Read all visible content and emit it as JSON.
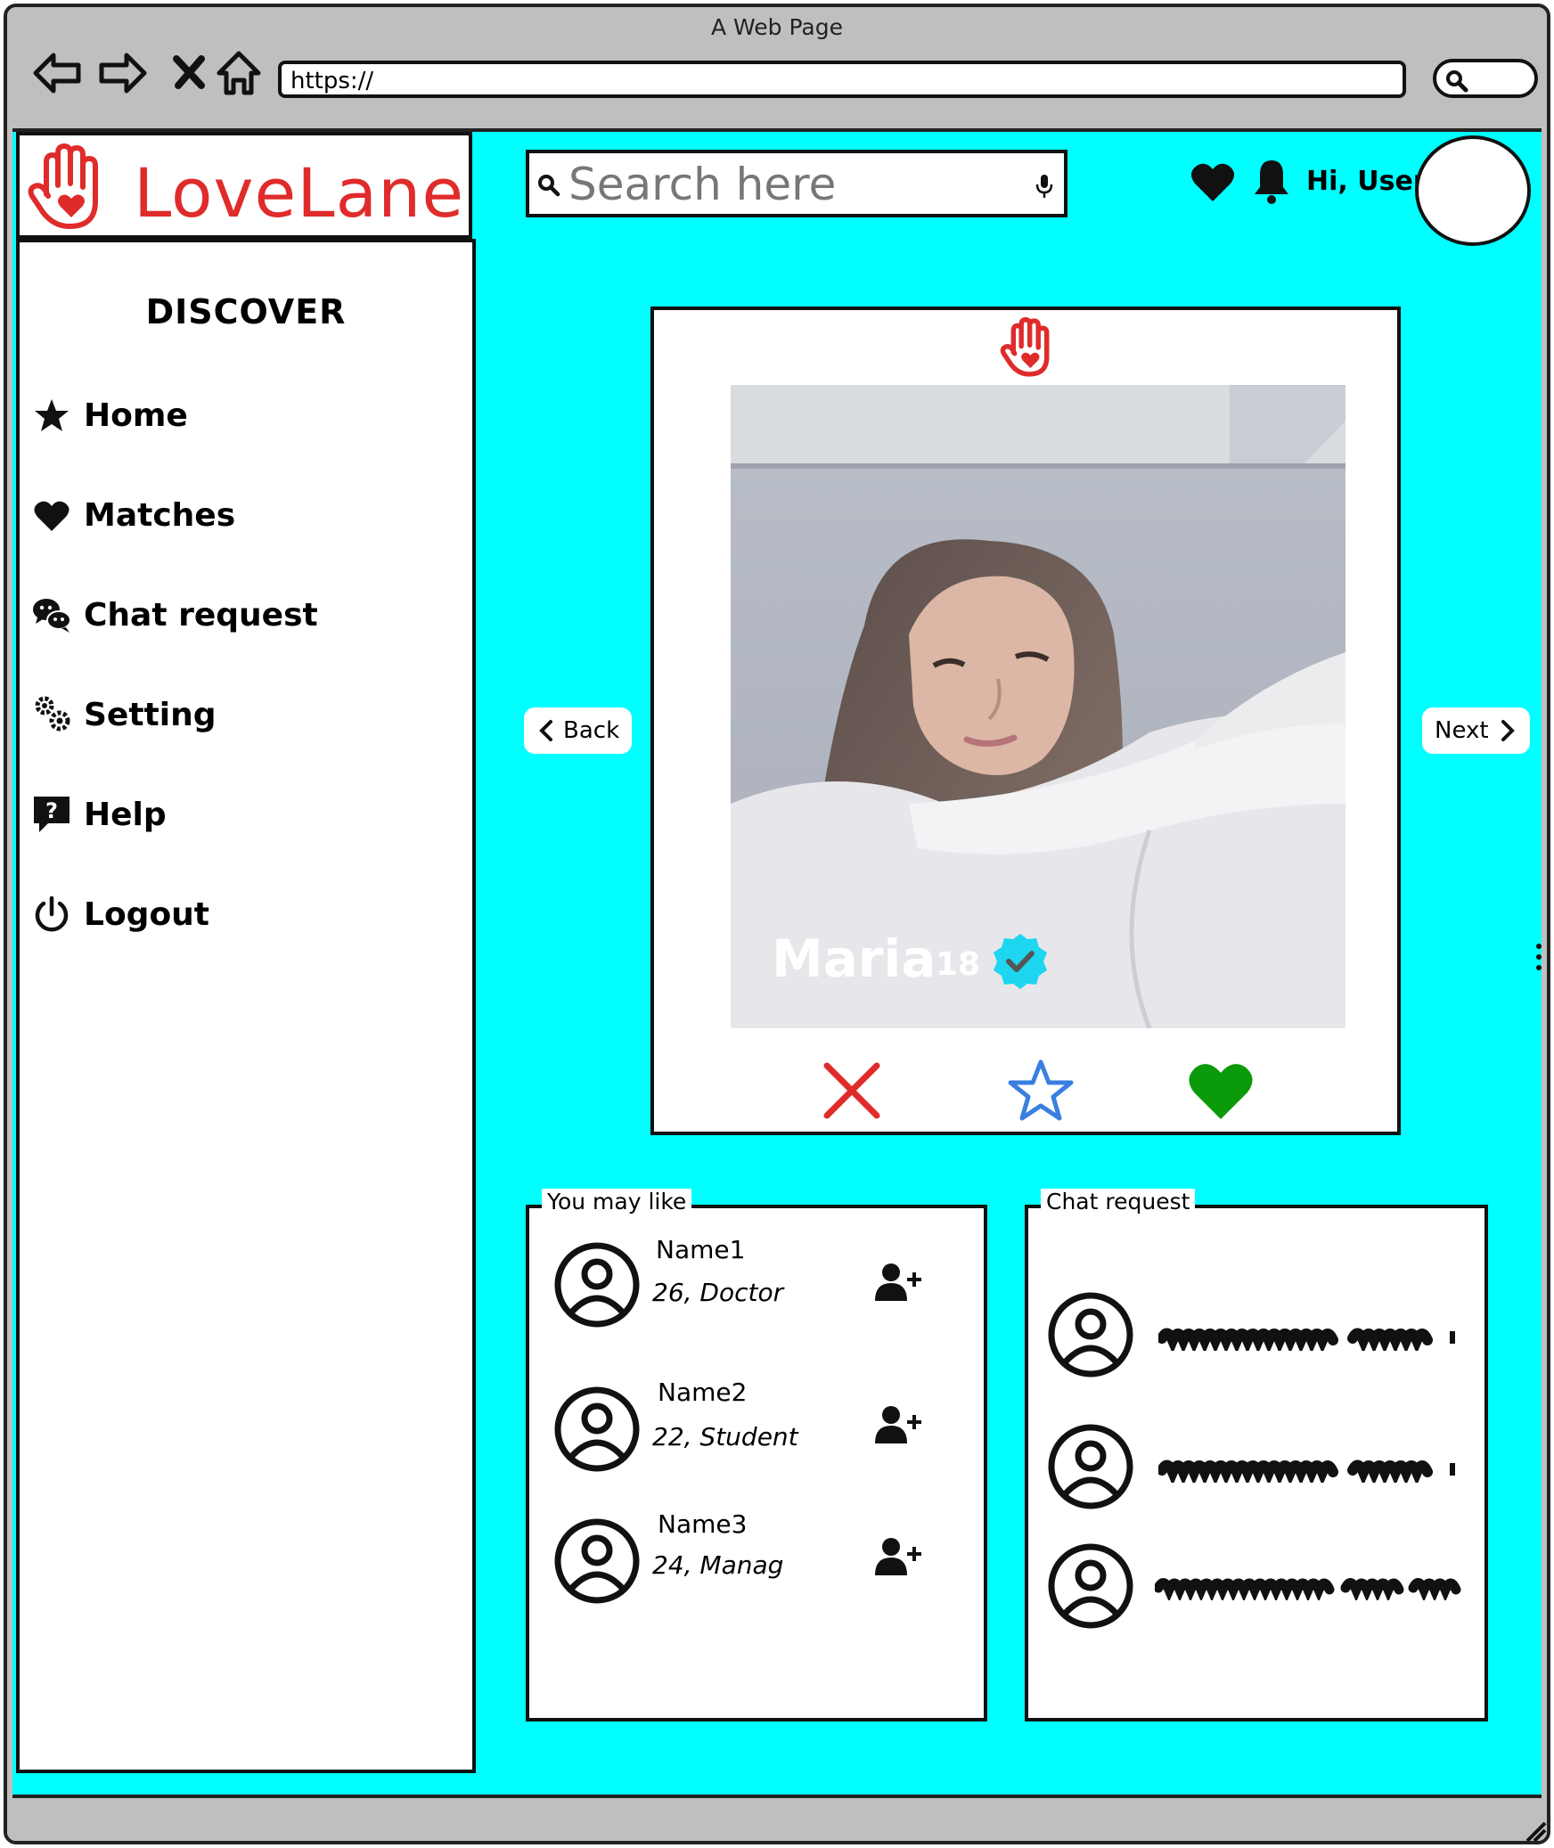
{
  "browser": {
    "title": "A Web Page",
    "url": "https://"
  },
  "brand": {
    "name": "LoveLane",
    "color": "#e02b2b"
  },
  "sidebar": {
    "heading": "DISCOVER",
    "items": [
      {
        "label": "Home",
        "icon": "star-icon"
      },
      {
        "label": "Matches",
        "icon": "heart-icon"
      },
      {
        "label": "Chat request",
        "icon": "chat-icon"
      },
      {
        "label": "Setting",
        "icon": "gears-icon"
      },
      {
        "label": "Help",
        "icon": "help-icon"
      },
      {
        "label": "Logout",
        "icon": "power-icon"
      }
    ]
  },
  "header": {
    "search_placeholder": "Search here",
    "greeting": "Hi, User"
  },
  "profile": {
    "name": "Maria",
    "age": "18",
    "verified": true
  },
  "navigation": {
    "back_label": "Back",
    "next_label": "Next"
  },
  "you_may_like": {
    "title": "You may like",
    "people": [
      {
        "name": "Name1",
        "detail": "26, Doctor"
      },
      {
        "name": "Name2",
        "detail": "22, Student"
      },
      {
        "name": "Name3",
        "detail": "24, Manag"
      }
    ]
  },
  "chat_requests": {
    "title": "Chat request",
    "count": 3
  },
  "colors": {
    "background": "#00ffff",
    "reject": "#e02b2b",
    "superlike": "#3a7fe0",
    "like": "#0a9a0a",
    "verified": "#1ed6f0"
  }
}
